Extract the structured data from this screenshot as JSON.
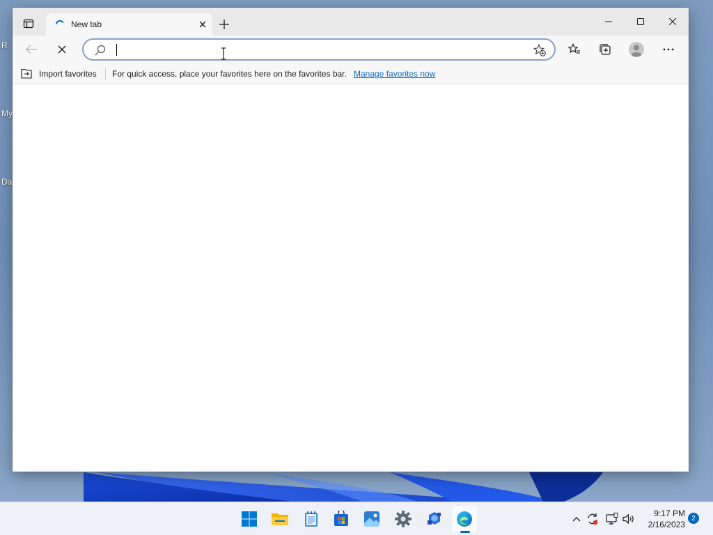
{
  "desktop": {
    "icon_labels": [
      "R",
      "My",
      "Da"
    ]
  },
  "browser": {
    "tab": {
      "title": "New tab"
    },
    "address_bar": {
      "value": "",
      "placeholder": ""
    },
    "favorites_bar": {
      "import_label": "Import favorites",
      "message": "For quick access, place your favorites here on the favorites bar.",
      "manage_link": "Manage favorites now"
    }
  },
  "taskbar": {
    "apps": [
      "start-icon",
      "file-explorer-icon",
      "notepad-icon",
      "store-icon",
      "photos-icon",
      "settings-icon",
      "app-icon",
      "edge-icon"
    ],
    "clock": {
      "time": "9:17 PM",
      "date": "2/16/2023"
    },
    "notification_count": "2"
  },
  "colors": {
    "accent": "#0067c0",
    "link": "#0f6cbd",
    "titlebar": "#e9e9e9",
    "toolbar": "#f7f7f7",
    "address_border": "#8aa1c4"
  }
}
